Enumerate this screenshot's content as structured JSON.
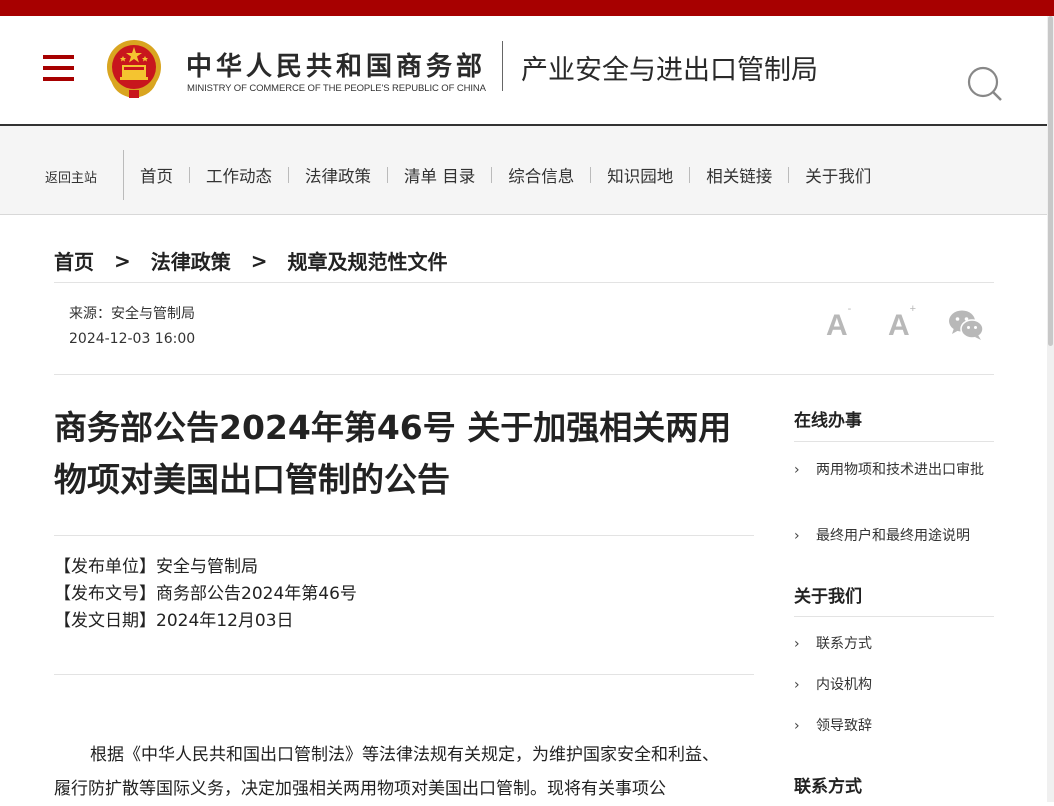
{
  "header": {
    "org_cn": "中华人民共和国商务部",
    "org_en": "MINISTRY OF COMMERCE OF THE PEOPLE'S REPUBLIC OF CHINA",
    "bureau": "产业安全与进出口管制局",
    "brand_color": "#a70000"
  },
  "nav": {
    "home_link": "返回主站",
    "items": [
      "首页",
      "工作动态",
      "法律政策",
      "清单 目录",
      "综合信息",
      "知识园地",
      "相关链接",
      "关于我们"
    ]
  },
  "breadcrumb": [
    "首页",
    "法律政策",
    "规章及规范性文件"
  ],
  "breadcrumb_sep": ">",
  "article": {
    "source": "来源：安全与管制局",
    "time": "2024-12-03 16:00",
    "font_small": "A",
    "font_small_sup": "-",
    "font_large": "A",
    "font_large_sup": "+",
    "title": "商务部公告2024年第46号 关于加强相关两用物项对美国出口管制的公告",
    "meta": [
      "【发布单位】安全与管制局",
      "【发布文号】商务部公告2024年第46号",
      "【发文日期】2024年12月03日"
    ],
    "body": "根据《中华人民共和国出口管制法》等法律法规有关规定，为维护国家安全和利益、履行防扩散等国际义务，决定加强相关两用物项对美国出口管制。现将有关事项公"
  },
  "sidebar": {
    "online_title": "在线办事",
    "online_items": [
      "两用物项和技术进出口审批",
      "最终用户和最终用途说明"
    ],
    "about_title": "关于我们",
    "about_items": [
      "联系方式",
      "内设机构",
      "领导致辞"
    ],
    "contact_title": "联系方式",
    "chevron": "›"
  }
}
